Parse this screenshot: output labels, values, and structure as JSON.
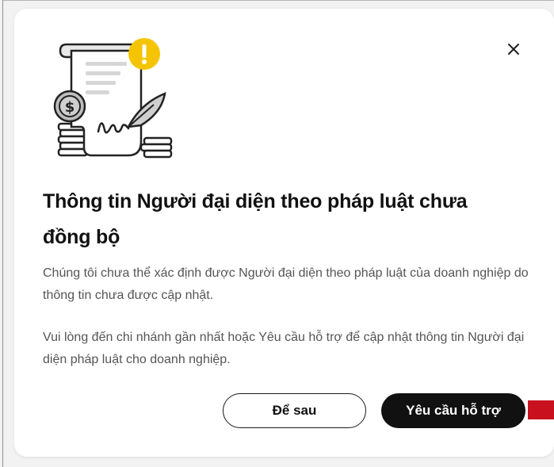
{
  "dialog": {
    "title": "Thông tin Người đại diện theo pháp luật chưa đồng bộ",
    "description_1": "Chúng tôi chưa thể xác định được Người đại diện theo pháp luật của doanh nghiệp do thông tin chưa được cập nhật.",
    "description_2": "Vui lòng đến chi nhánh gần nhất hoặc Yêu cầu hỗ trợ để cập nhật thông tin Người đại diện pháp luật cho doanh nghiệp.",
    "illustration_icon": "contract-document-icon",
    "close_icon": "close-icon"
  },
  "actions": {
    "later_label": "Để sau",
    "support_label": "Yêu cầu hỗ trợ"
  },
  "colors": {
    "primary_button_bg": "#111111",
    "warning_badge": "#f5c400",
    "accent_marker": "#c8101e",
    "body_text": "#555555",
    "title_text": "#111111"
  }
}
